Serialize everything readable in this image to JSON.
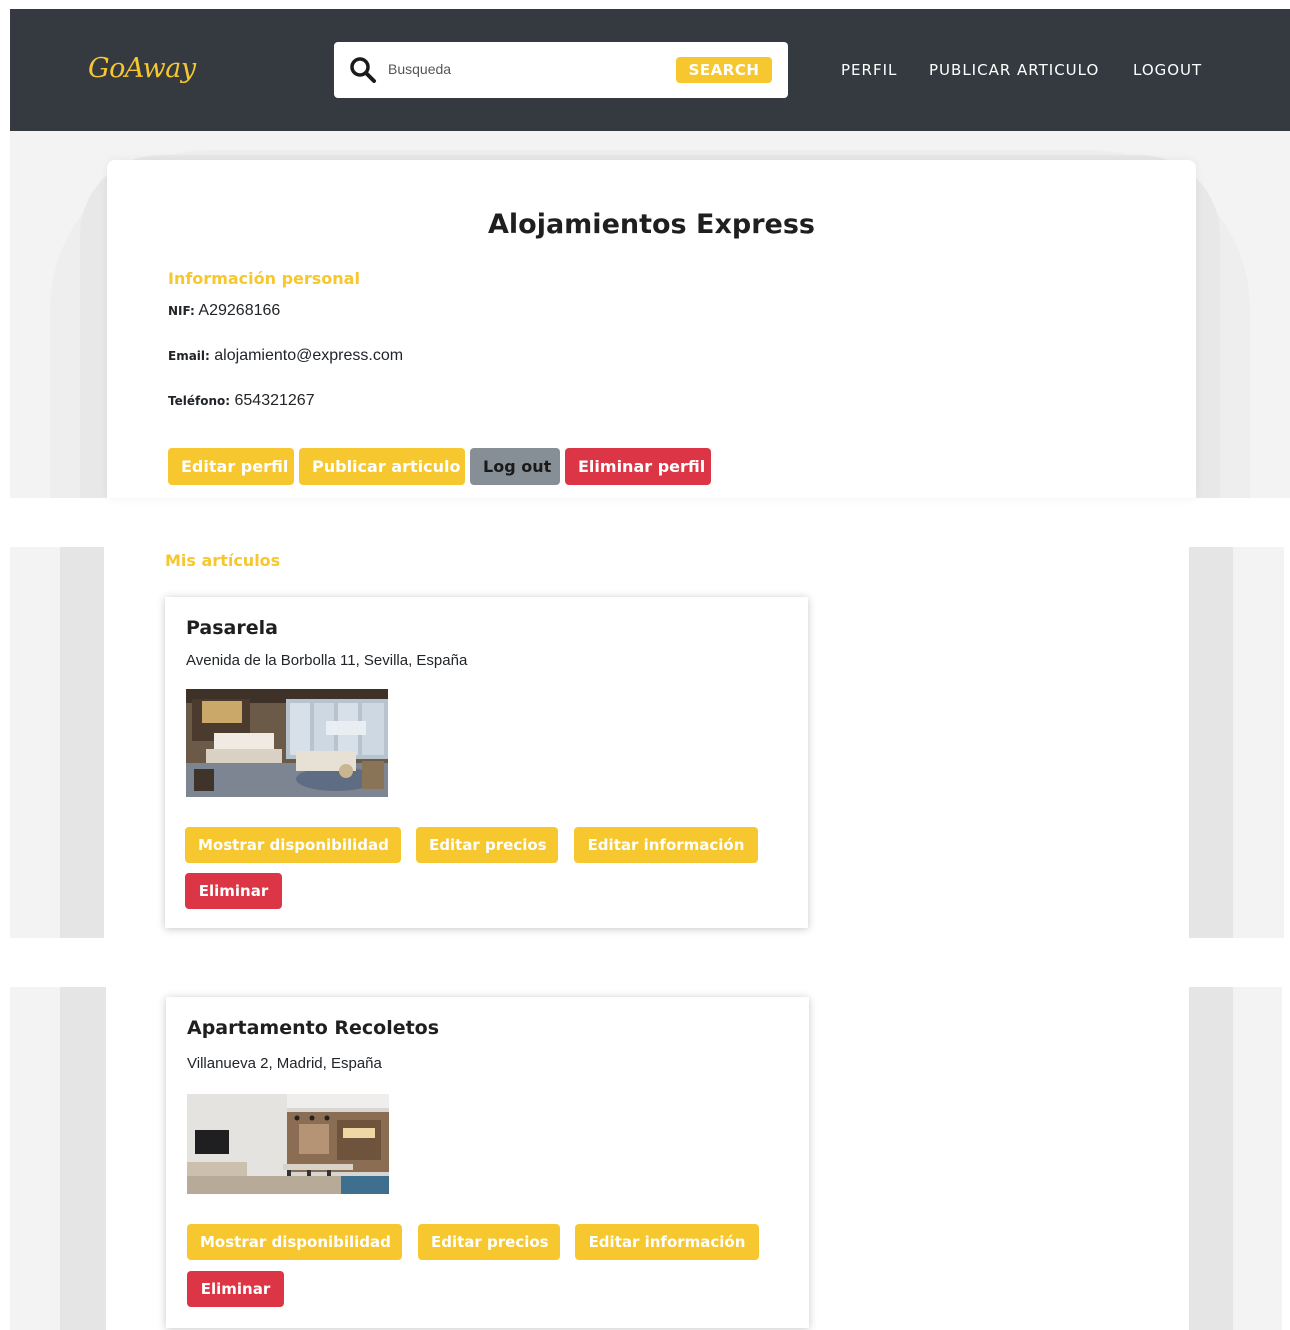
{
  "navbar": {
    "brand": "GoAway",
    "search": {
      "placeholder": "Busqueda",
      "button_label": "SEARCH"
    },
    "links": [
      "PERFIL",
      "PUBLICAR ARTICULO",
      "LOGOUT"
    ]
  },
  "profile": {
    "name": "Alojamientos Express",
    "section_title": "Información personal",
    "nif_label": "NIF:",
    "nif": "A29268166",
    "email_label": "Email:",
    "email": "alojamiento@express.com",
    "phone_label": "Teléfono:",
    "phone": "654321267",
    "buttons": {
      "edit": "Editar perfil",
      "publish": "Publicar articulo",
      "logout": "Log out",
      "delete": "Eliminar perfil"
    }
  },
  "articles_section_title": "Mis artículos",
  "articles": [
    {
      "title": "Pasarela",
      "address": "Avenida de la Borbolla 11, Sevilla, España",
      "btn_availability": "Mostrar disponibilidad",
      "btn_prices": "Editar precios",
      "btn_info": "Editar información",
      "btn_delete": "Eliminar"
    },
    {
      "title": "Apartamento Recoletos",
      "address": "Villanueva 2, Madrid, España",
      "btn_availability": "Mostrar disponibilidad",
      "btn_prices": "Editar precios",
      "btn_info": "Editar información",
      "btn_delete": "Eliminar"
    }
  ],
  "colors": {
    "navbar_bg": "#343a40",
    "accent_yellow": "#f7c72f",
    "danger_red": "#dc3545",
    "secondary_gray": "#868e96",
    "page_bg": "#f3f3f3"
  }
}
